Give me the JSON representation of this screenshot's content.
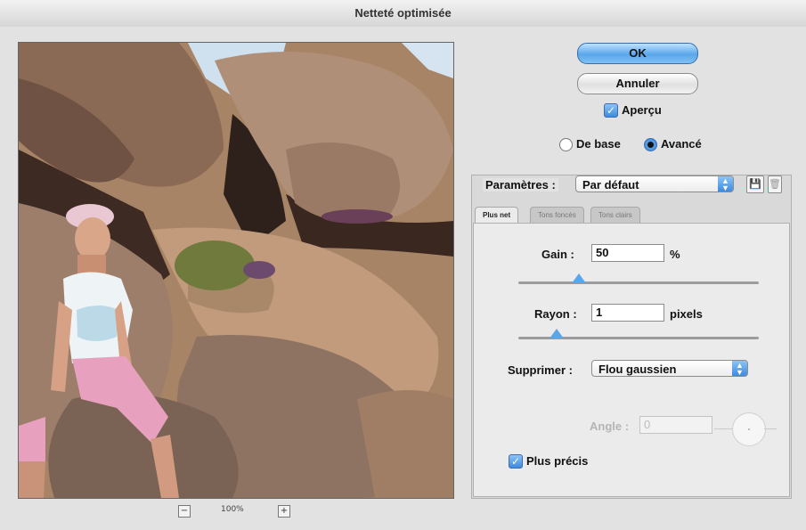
{
  "window": {
    "title": "Netteté optimisée"
  },
  "buttons": {
    "ok": "OK",
    "cancel": "Annuler"
  },
  "preview_checkbox": {
    "label": "Aperçu",
    "checked": true
  },
  "mode": {
    "basic": "De base",
    "advanced": "Avancé",
    "selected": "advanced"
  },
  "settings": {
    "label": "Paramètres :",
    "value": "Par défaut"
  },
  "tabs": [
    {
      "label": "Plus net",
      "active": true
    },
    {
      "label": "Tons foncés",
      "active": false
    },
    {
      "label": "Tons clairs",
      "active": false
    }
  ],
  "amount": {
    "label": "Gain :",
    "value": "50",
    "unit": "%",
    "slider_fraction": 0.25
  },
  "radius": {
    "label": "Rayon :",
    "value": "1",
    "unit": "pixels",
    "slider_fraction": 0.16
  },
  "remove": {
    "label": "Supprimer :",
    "value": "Flou gaussien"
  },
  "angle": {
    "label": "Angle :",
    "value": "0"
  },
  "more_accurate": {
    "label": "Plus précis",
    "checked": true
  },
  "zoom": {
    "level": "100%",
    "zoom_out": "−",
    "zoom_in": "+"
  },
  "icons": {
    "save_preset": "save-preset-icon",
    "delete_preset": "trash-icon"
  }
}
